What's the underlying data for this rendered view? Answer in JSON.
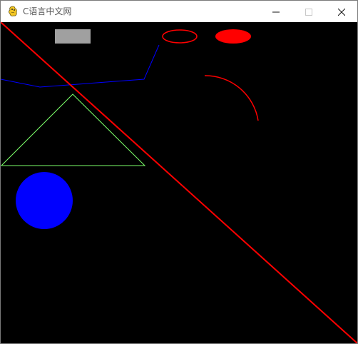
{
  "window": {
    "title": "C语言中文网",
    "controls": {
      "minimize_icon": "minimize-icon",
      "maximize_icon": "maximize-icon",
      "close_icon": "close-icon"
    }
  },
  "canvas": {
    "background_color": "#000000",
    "colors": {
      "gray_rect": "#a0a0a0",
      "red": "#ff0000",
      "blue": "#0000ff",
      "green": "#7cff6a"
    }
  }
}
